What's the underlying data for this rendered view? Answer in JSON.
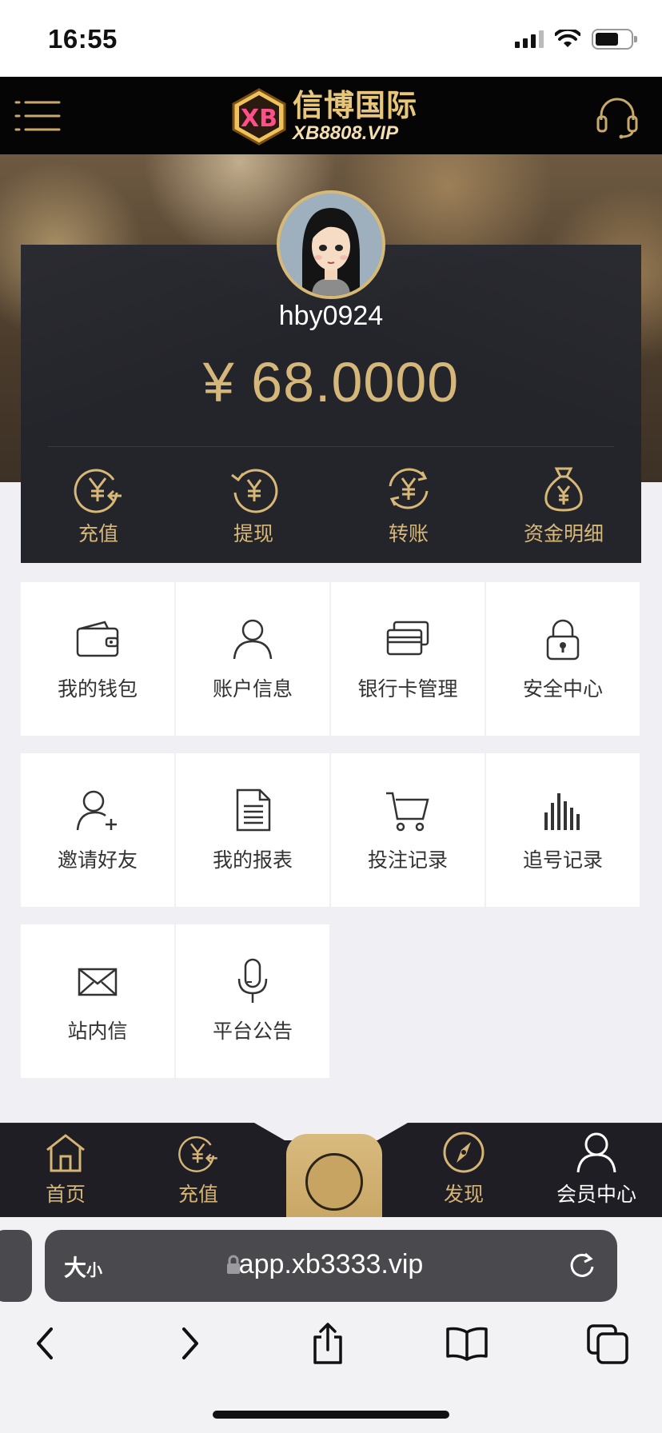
{
  "status_bar": {
    "time": "16:55"
  },
  "header": {
    "logo_cn": "信博国际",
    "logo_en": "XB8808.VIP",
    "logo_badge": "XB"
  },
  "profile": {
    "username": "hby0924",
    "balance": "¥ 68.0000"
  },
  "quick_actions": [
    {
      "label": "充值",
      "icon": "deposit-icon"
    },
    {
      "label": "提现",
      "icon": "withdraw-icon"
    },
    {
      "label": "转账",
      "icon": "transfer-icon"
    },
    {
      "label": "资金明细",
      "icon": "money-bag-icon"
    }
  ],
  "menu_tiles": [
    {
      "label": "我的钱包",
      "icon": "wallet-icon"
    },
    {
      "label": "账户信息",
      "icon": "user-icon"
    },
    {
      "label": "银行卡管理",
      "icon": "bank-card-icon"
    },
    {
      "label": "安全中心",
      "icon": "lock-icon"
    },
    {
      "label": "邀请好友",
      "icon": "add-user-icon"
    },
    {
      "label": "我的报表",
      "icon": "document-icon"
    },
    {
      "label": "投注记录",
      "icon": "cart-icon"
    },
    {
      "label": "追号记录",
      "icon": "bar-chart-icon"
    },
    {
      "label": "站内信",
      "icon": "mail-icon"
    },
    {
      "label": "平台公告",
      "icon": "microphone-icon"
    }
  ],
  "tabbar": {
    "items": [
      {
        "label": "首页",
        "icon": "home-icon"
      },
      {
        "label": "充值",
        "icon": "deposit-icon"
      },
      {
        "label": "发现",
        "icon": "compass-icon"
      },
      {
        "label": "会员中心",
        "icon": "member-icon"
      }
    ],
    "active_color": "#ffffff",
    "inactive_color": "#d6b574"
  },
  "browser": {
    "text_size_label": "大",
    "text_size_small": "小",
    "url": "app.xb3333.vip"
  },
  "colors": {
    "gold": "#d6b77a",
    "card": "#24242b",
    "header": "#050505"
  }
}
